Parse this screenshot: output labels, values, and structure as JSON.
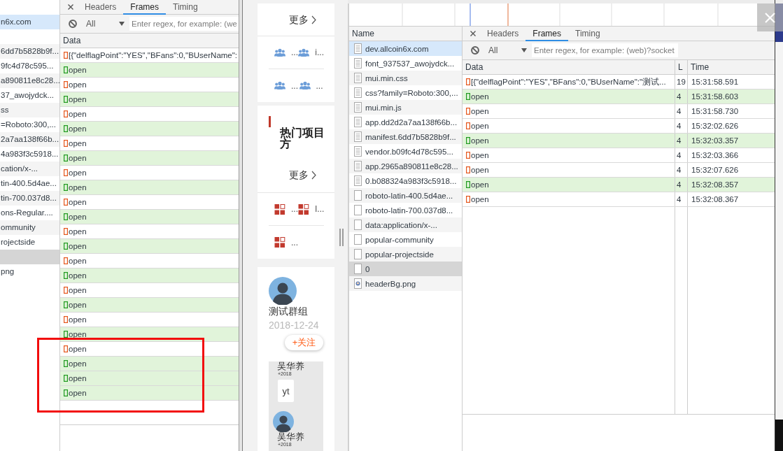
{
  "left_devtools": {
    "requests": [
      {
        "label": "n6x.com",
        "selected": true,
        "hovered": false
      },
      {
        "selected": false,
        "hovered": false
      },
      {
        "label": "6dd7b5828b9f...",
        "selected": false,
        "hovered": false
      },
      {
        "label": "9fc4d78c595...",
        "selected": false,
        "hovered": false
      },
      {
        "label": "a890811e8c28...",
        "selected": false,
        "hovered": false
      },
      {
        "label": "37_awojydck...",
        "selected": false,
        "hovered": false
      },
      {
        "label": "ss",
        "selected": false,
        "hovered": false
      },
      {
        "label": "=Roboto:300,...",
        "selected": false,
        "hovered": false
      },
      {
        "label": "2a7aa138f66b...",
        "selected": false,
        "hovered": false
      },
      {
        "label": "4a983f3c5918...",
        "selected": false,
        "hovered": false
      },
      {
        "label": "cation/x-...",
        "selected": false,
        "hovered": false
      },
      {
        "label": "tin-400.5d4ae...",
        "selected": false,
        "hovered": false
      },
      {
        "label": "tin-700.037d8...",
        "selected": false,
        "hovered": false
      },
      {
        "label": "ons-Regular....",
        "selected": false,
        "hovered": false
      },
      {
        "label": "ommunity",
        "selected": false,
        "hovered": false
      },
      {
        "label": "rojectside",
        "selected": false,
        "hovered": false
      },
      {
        "selected": false,
        "hovered": true
      },
      {
        "label": "png",
        "selected": false,
        "hovered": false
      }
    ],
    "tabs": [
      {
        "label": "Headers",
        "selected": false
      },
      {
        "label": "Frames",
        "selected": true
      },
      {
        "label": "Timing",
        "selected": false
      }
    ],
    "filter_bar": {
      "type": "All",
      "search": {
        "placeholder": "Enter regex, for example: (we"
      }
    },
    "columns": [
      "Data"
    ],
    "frames": [
      {
        "kind": "sent",
        "data": "[{\"delflagPoint\":\"YES\",\"BFans\":0,\"BUserName\":"
      },
      {
        "kind": "received",
        "data": "open"
      },
      {
        "kind": "sent",
        "data": "open"
      },
      {
        "kind": "received",
        "data": "open"
      },
      {
        "kind": "sent",
        "data": "open"
      },
      {
        "kind": "received",
        "data": "open"
      },
      {
        "kind": "sent",
        "data": "open"
      },
      {
        "kind": "received",
        "data": "open"
      },
      {
        "kind": "sent",
        "data": "open"
      },
      {
        "kind": "received",
        "data": "open"
      },
      {
        "kind": "sent",
        "data": "open"
      },
      {
        "kind": "received",
        "data": "open"
      },
      {
        "kind": "sent",
        "data": "open"
      },
      {
        "kind": "received",
        "data": "open"
      },
      {
        "kind": "sent",
        "data": "open"
      },
      {
        "kind": "received",
        "data": "open"
      },
      {
        "kind": "sent",
        "data": "open"
      },
      {
        "kind": "received",
        "data": "open"
      },
      {
        "kind": "sent",
        "data": "open"
      },
      {
        "kind": "received",
        "data": "open"
      },
      {
        "kind": "sent",
        "data": "open"
      },
      {
        "kind": "received",
        "data": "open"
      },
      {
        "kind": "received",
        "data": "open"
      },
      {
        "kind": "received",
        "data": "open"
      }
    ]
  },
  "mobile_page": {
    "community": {
      "more": "更多",
      "rows": [
        {
          "items": [
            {
              "label": "..."
            },
            {
              "label": "i..."
            }
          ]
        },
        {
          "items": [
            {
              "label": "..."
            },
            {
              "label": "..."
            }
          ]
        }
      ]
    },
    "projects": {
      "title": "热门项目方",
      "more": "更多",
      "rows": [
        {
          "items": [
            {
              "label": "..."
            },
            {
              "label": "I..."
            }
          ]
        },
        {
          "items": [
            {
              "label": "..."
            }
          ]
        }
      ]
    },
    "group": {
      "name": "测试群组",
      "date": "2018-12-24",
      "follow_button": "+关注",
      "members": [
        {
          "kind": "name",
          "name": "吴华养",
          "note": "+2018"
        },
        {
          "kind": "tile",
          "label": "yt"
        },
        {
          "kind": "avatar",
          "name": "吴华养",
          "note": "+2018"
        }
      ]
    }
  },
  "right_devtools": {
    "name_header": "Name",
    "requests": [
      {
        "name": "dev.allcoin6x.com",
        "kind": "document",
        "selected": true,
        "hovered": false
      },
      {
        "name": "font_937537_awojydck...",
        "kind": "document",
        "selected": false,
        "hovered": false
      },
      {
        "name": "mui.min.css",
        "kind": "document",
        "selected": false,
        "hovered": false
      },
      {
        "name": "css?family=Roboto:300,...",
        "kind": "document",
        "selected": false,
        "hovered": false
      },
      {
        "name": "mui.min.js",
        "kind": "document",
        "selected": false,
        "hovered": false
      },
      {
        "name": "app.dd2d2a7aa138f66b...",
        "kind": "document",
        "selected": false,
        "hovered": false
      },
      {
        "name": "manifest.6dd7b5828b9f...",
        "kind": "document",
        "selected": false,
        "hovered": false
      },
      {
        "name": "vendor.b09fc4d78c595...",
        "kind": "document",
        "selected": false,
        "hovered": false
      },
      {
        "name": "app.2965a890811e8c28...",
        "kind": "document",
        "selected": false,
        "hovered": false
      },
      {
        "name": "0.b088324a983f3c5918...",
        "kind": "document",
        "selected": false,
        "hovered": false
      },
      {
        "name": "roboto-latin-400.5d4ae...",
        "kind": "file",
        "selected": false,
        "hovered": false
      },
      {
        "name": "roboto-latin-700.037d8...",
        "kind": "file",
        "selected": false,
        "hovered": false
      },
      {
        "name": "data:application/x-...",
        "kind": "file",
        "selected": false,
        "hovered": false
      },
      {
        "name": "popular-community",
        "kind": "file",
        "selected": false,
        "hovered": false
      },
      {
        "name": "popular-projectside",
        "kind": "file",
        "selected": false,
        "hovered": false
      },
      {
        "name": "0",
        "kind": "file",
        "selected": false,
        "hovered": true
      },
      {
        "name": "headerBg.png",
        "kind": "image",
        "selected": false,
        "hovered": false
      }
    ],
    "tabs": [
      {
        "label": "Headers",
        "selected": false
      },
      {
        "label": "Frames",
        "selected": true
      },
      {
        "label": "Timing",
        "selected": false
      }
    ],
    "filter_bar": {
      "type": "All",
      "search": {
        "placeholder": "Enter regex, for example: (web)?socket"
      }
    },
    "columns": [
      "Data",
      "L",
      "Time"
    ],
    "frames": [
      {
        "kind": "sent",
        "data": "[{\"delflagPoint\":\"YES\",\"BFans\":0,\"BUserName\":\"测试...",
        "length": "19",
        "time": "15:31:58.591"
      },
      {
        "kind": "received",
        "data": "open",
        "length": "4",
        "time": "15:31:58.603"
      },
      {
        "kind": "sent",
        "data": "open",
        "length": "4",
        "time": "15:31:58.730"
      },
      {
        "kind": "sent",
        "data": "open",
        "length": "4",
        "time": "15:32:02.626"
      },
      {
        "kind": "received",
        "data": "open",
        "length": "4",
        "time": "15:32:03.357"
      },
      {
        "kind": "sent",
        "data": "open",
        "length": "4",
        "time": "15:32:03.366"
      },
      {
        "kind": "sent",
        "data": "open",
        "length": "4",
        "time": "15:32:07.626"
      },
      {
        "kind": "received",
        "data": "open",
        "length": "4",
        "time": "15:32:08.357"
      },
      {
        "kind": "sent",
        "data": "open",
        "length": "4",
        "time": "15:32:08.367"
      }
    ]
  }
}
